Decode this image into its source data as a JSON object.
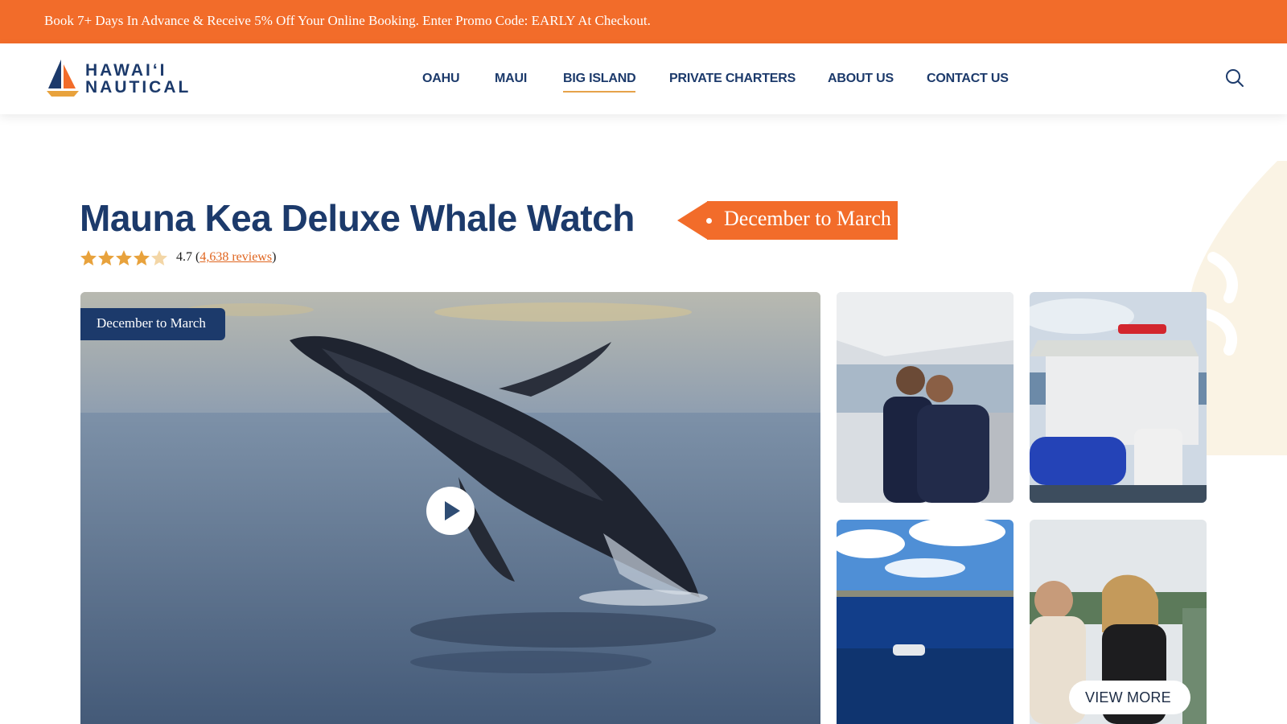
{
  "promo": {
    "text": "Book 7+ Days In Advance & Receive 5% Off Your Online Booking. Enter Promo Code: EARLY At Checkout."
  },
  "brand": {
    "line1": "HAWAI‘I",
    "line2": "NAUTICAL"
  },
  "nav": {
    "items": [
      {
        "label": "OAHU",
        "active": false
      },
      {
        "label": "MAUI",
        "active": false
      },
      {
        "label": "BIG ISLAND",
        "active": true
      },
      {
        "label": "PRIVATE CHARTERS",
        "active": false
      },
      {
        "label": "ABOUT US",
        "active": false
      },
      {
        "label": "CONTACT US",
        "active": false
      }
    ],
    "search_icon": "search-icon"
  },
  "tour": {
    "title": "Mauna Kea Deluxe Whale Watch",
    "season_tag": "December to March",
    "rating": {
      "score": "4.7",
      "reviews": "4,638 reviews",
      "stars": 4.7
    }
  },
  "gallery": {
    "main_badge": "December to March",
    "view_more": "VIEW MORE"
  },
  "colors": {
    "accent_orange": "#f26c2a",
    "navy": "#1c3a6b",
    "star_gold": "#e8a23c"
  }
}
